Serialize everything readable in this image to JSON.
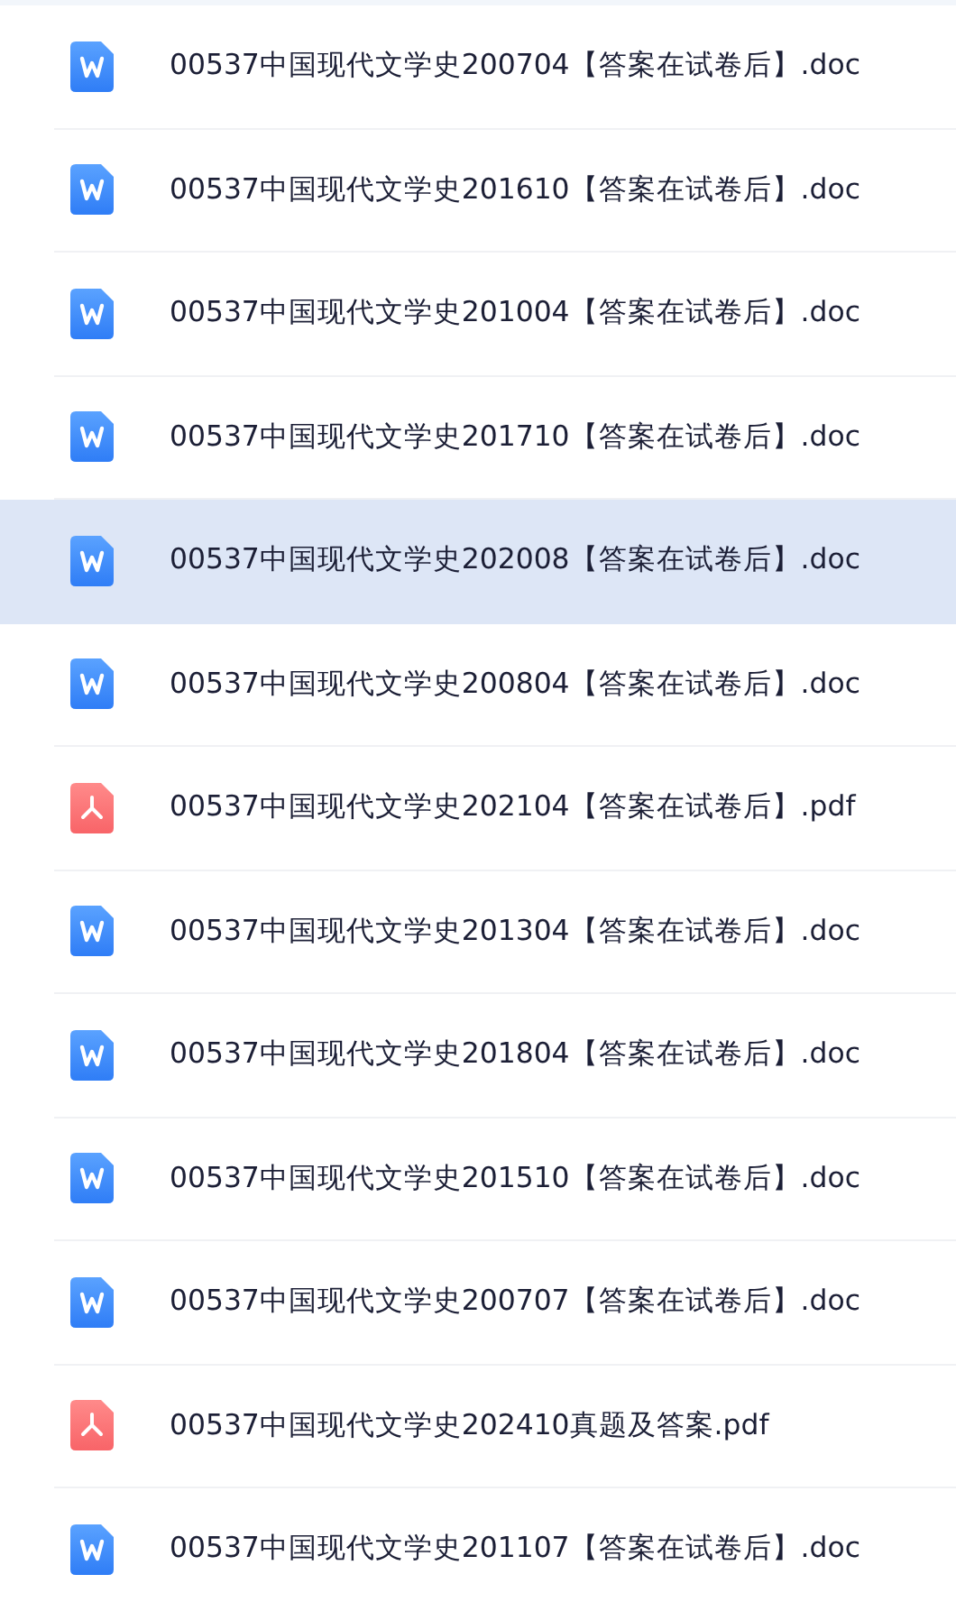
{
  "files": [
    {
      "name": "00537中国现代文学史200704【答案在试卷后】.doc",
      "kind": "doc",
      "highlighted": false
    },
    {
      "name": "00537中国现代文学史201610【答案在试卷后】.doc",
      "kind": "doc",
      "highlighted": false
    },
    {
      "name": "00537中国现代文学史201004【答案在试卷后】.doc",
      "kind": "doc",
      "highlighted": false
    },
    {
      "name": "00537中国现代文学史201710【答案在试卷后】.doc",
      "kind": "doc",
      "highlighted": false
    },
    {
      "name": "00537中国现代文学史202008【答案在试卷后】.doc",
      "kind": "doc",
      "highlighted": true
    },
    {
      "name": "00537中国现代文学史200804【答案在试卷后】.doc",
      "kind": "doc",
      "highlighted": false
    },
    {
      "name": "00537中国现代文学史202104【答案在试卷后】.pdf",
      "kind": "pdf",
      "highlighted": false
    },
    {
      "name": "00537中国现代文学史201304【答案在试卷后】.doc",
      "kind": "doc",
      "highlighted": false
    },
    {
      "name": "00537中国现代文学史201804【答案在试卷后】.doc",
      "kind": "doc",
      "highlighted": false
    },
    {
      "name": "00537中国现代文学史201510【答案在试卷后】.doc",
      "kind": "doc",
      "highlighted": false
    },
    {
      "name": "00537中国现代文学史200707【答案在试卷后】.doc",
      "kind": "doc",
      "highlighted": false
    },
    {
      "name": "00537中国现代文学史202410真题及答案.pdf",
      "kind": "pdf",
      "highlighted": false
    },
    {
      "name": "00537中国现代文学史201107【答案在试卷后】.doc",
      "kind": "doc",
      "highlighted": false
    }
  ]
}
